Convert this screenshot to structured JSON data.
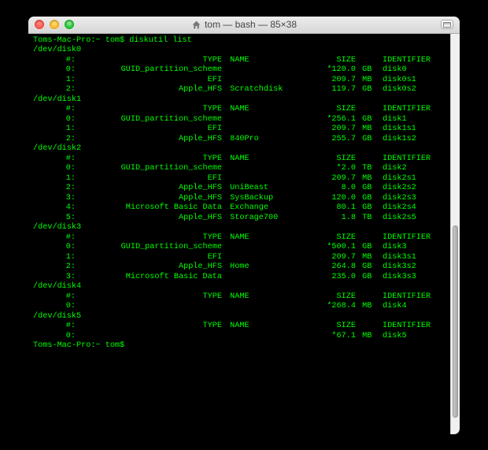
{
  "window": {
    "title": "tom — bash — 85×38",
    "traffic": {
      "close": "Close",
      "minimize": "Minimize",
      "zoom": "Zoom"
    }
  },
  "prompt1": "Toms-Mac-Pro:~ tom$ diskutil list",
  "prompt2": "Toms-Mac-Pro:~ tom$ ",
  "hdr": {
    "idx": "#:",
    "type": "TYPE",
    "name": "NAME",
    "size": "SIZE",
    "id": "IDENTIFIER"
  },
  "disks": [
    {
      "dev": "/dev/disk0",
      "vols": [
        {
          "idx": "0:",
          "type": "GUID_partition_scheme",
          "name": "",
          "size": "*120.0",
          "unit": "GB",
          "id": "disk0"
        },
        {
          "idx": "1:",
          "type": "EFI",
          "name": "",
          "size": "209.7",
          "unit": "MB",
          "id": "disk0s1"
        },
        {
          "idx": "2:",
          "type": "Apple_HFS",
          "name": "Scratchdisk",
          "size": "119.7",
          "unit": "GB",
          "id": "disk0s2"
        }
      ]
    },
    {
      "dev": "/dev/disk1",
      "vols": [
        {
          "idx": "0:",
          "type": "GUID_partition_scheme",
          "name": "",
          "size": "*256.1",
          "unit": "GB",
          "id": "disk1"
        },
        {
          "idx": "1:",
          "type": "EFI",
          "name": "",
          "size": "209.7",
          "unit": "MB",
          "id": "disk1s1"
        },
        {
          "idx": "2:",
          "type": "Apple_HFS",
          "name": "840Pro",
          "size": "255.7",
          "unit": "GB",
          "id": "disk1s2"
        }
      ]
    },
    {
      "dev": "/dev/disk2",
      "vols": [
        {
          "idx": "0:",
          "type": "GUID_partition_scheme",
          "name": "",
          "size": "*2.0",
          "unit": "TB",
          "id": "disk2"
        },
        {
          "idx": "1:",
          "type": "EFI",
          "name": "",
          "size": "209.7",
          "unit": "MB",
          "id": "disk2s1"
        },
        {
          "idx": "2:",
          "type": "Apple_HFS",
          "name": "UniBeast",
          "size": "8.0",
          "unit": "GB",
          "id": "disk2s2"
        },
        {
          "idx": "3:",
          "type": "Apple_HFS",
          "name": "SysBackup",
          "size": "120.0",
          "unit": "GB",
          "id": "disk2s3"
        },
        {
          "idx": "4:",
          "type": "Microsoft Basic Data",
          "name": "Exchange",
          "size": "80.1",
          "unit": "GB",
          "id": "disk2s4"
        },
        {
          "idx": "5:",
          "type": "Apple_HFS",
          "name": "Storage700",
          "size": "1.8",
          "unit": "TB",
          "id": "disk2s5"
        }
      ]
    },
    {
      "dev": "/dev/disk3",
      "vols": [
        {
          "idx": "0:",
          "type": "GUID_partition_scheme",
          "name": "",
          "size": "*500.1",
          "unit": "GB",
          "id": "disk3"
        },
        {
          "idx": "1:",
          "type": "EFI",
          "name": "",
          "size": "209.7",
          "unit": "MB",
          "id": "disk3s1"
        },
        {
          "idx": "2:",
          "type": "Apple_HFS",
          "name": "Home",
          "size": "264.8",
          "unit": "GB",
          "id": "disk3s2"
        },
        {
          "idx": "3:",
          "type": "Microsoft Basic Data",
          "name": "",
          "size": "235.0",
          "unit": "GB",
          "id": "disk3s3"
        }
      ]
    },
    {
      "dev": "/dev/disk4",
      "vols": [
        {
          "idx": "0:",
          "type": "",
          "name": "",
          "size": "*268.4",
          "unit": "MB",
          "id": "disk4"
        }
      ]
    },
    {
      "dev": "/dev/disk5",
      "vols": [
        {
          "idx": "0:",
          "type": "",
          "name": "",
          "size": "*67.1",
          "unit": "MB",
          "id": "disk5"
        }
      ]
    }
  ]
}
